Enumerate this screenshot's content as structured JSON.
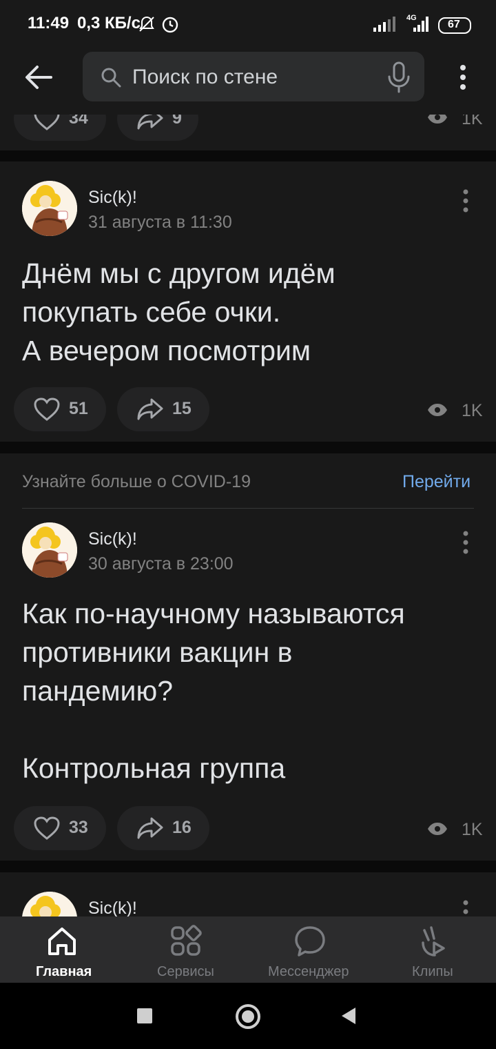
{
  "status": {
    "time": "11:49",
    "speed": "0,3 КБ/с",
    "battery": "67",
    "network": "4G"
  },
  "header": {
    "search_placeholder": "Поиск по стене"
  },
  "top_partial": {
    "likes": "34",
    "shares": "9",
    "views": "1K"
  },
  "posts": [
    {
      "author": "Sic(k)!",
      "date": "31 августа в 11:30",
      "text": "Днём мы с другом идём\nпокупать себе очки.\nА вечером посмотрим",
      "likes": "51",
      "shares": "15",
      "views": "1K"
    },
    {
      "author": "Sic(k)!",
      "date": "30 августа в 23:00",
      "text": "Как по-научному называются\nпротивники вакцин в\nпандемию?\n\nКонтрольная группа",
      "likes": "33",
      "shares": "16",
      "views": "1K"
    },
    {
      "author": "Sic(k)!"
    }
  ],
  "covid": {
    "text": "Узнайте больше о COVID-19",
    "link": "Перейти"
  },
  "nav": {
    "home": "Главная",
    "services": "Сервисы",
    "messenger": "Мессенджер",
    "clips": "Клипы"
  },
  "colors": {
    "accent": "#71aaeb",
    "background": "#191919",
    "page": "#0a0a0a"
  }
}
